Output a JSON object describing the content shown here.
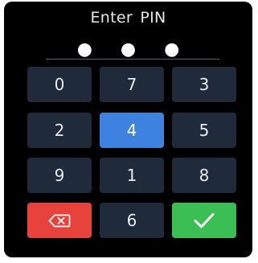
{
  "screen": {
    "title": "Enter PIN",
    "pin_mask": "● ● ●"
  },
  "keypad": {
    "keys": [
      {
        "label": "0"
      },
      {
        "label": "7"
      },
      {
        "label": "3"
      },
      {
        "label": "2"
      },
      {
        "label": "4",
        "selected": true
      },
      {
        "label": "5"
      },
      {
        "label": "9"
      },
      {
        "label": "1"
      },
      {
        "label": "8"
      },
      {
        "icon": "backspace-icon",
        "action": "delete"
      },
      {
        "label": "6"
      },
      {
        "icon": "checkmark-icon",
        "action": "confirm"
      }
    ]
  },
  "colors": {
    "background": "#000000",
    "key": "#1f2a3b",
    "key_selected": "#3c82de",
    "delete": "#e7423c",
    "confirm": "#3bbf55"
  }
}
